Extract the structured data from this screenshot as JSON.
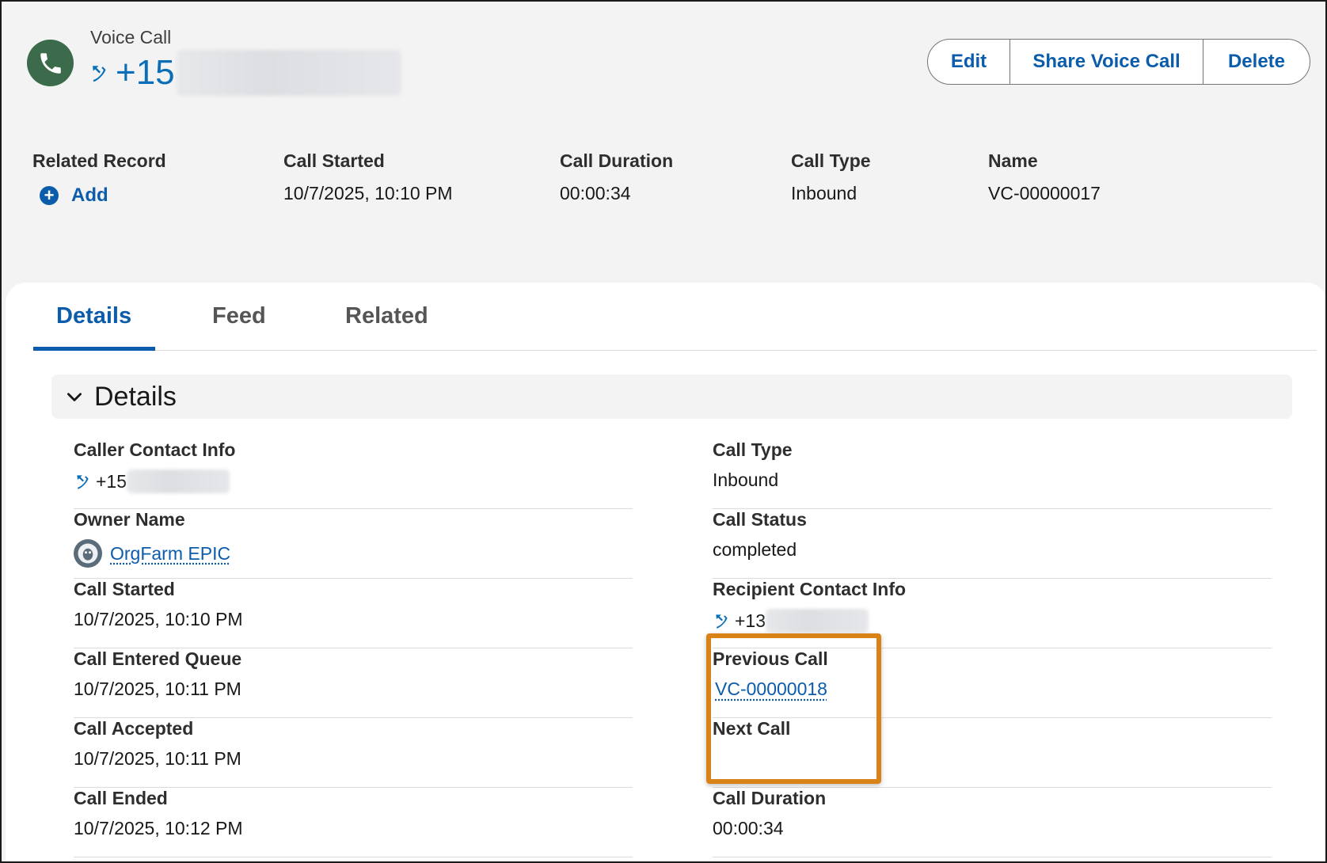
{
  "header": {
    "object_label": "Voice Call",
    "record_title_prefix": "+15",
    "actions": {
      "edit": "Edit",
      "share": "Share Voice Call",
      "delete": "Delete"
    },
    "highlights": {
      "related_record": {
        "label": "Related Record",
        "add_label": "Add"
      },
      "call_started": {
        "label": "Call Started",
        "value": "10/7/2025, 10:10 PM"
      },
      "call_duration": {
        "label": "Call Duration",
        "value": "00:00:34"
      },
      "call_type": {
        "label": "Call Type",
        "value": "Inbound"
      },
      "name": {
        "label": "Name",
        "value": "VC-00000017"
      }
    }
  },
  "tabs": {
    "details": "Details",
    "feed": "Feed",
    "related": "Related"
  },
  "section": {
    "title": "Details"
  },
  "fields_left": {
    "caller_contact_info": {
      "label": "Caller Contact Info",
      "value": "+15"
    },
    "owner_name": {
      "label": "Owner Name",
      "value": "OrgFarm EPIC"
    },
    "call_started": {
      "label": "Call Started",
      "value": "10/7/2025, 10:10 PM"
    },
    "call_entered_queue": {
      "label": "Call Entered Queue",
      "value": "10/7/2025, 10:11 PM"
    },
    "call_accepted": {
      "label": "Call Accepted",
      "value": "10/7/2025, 10:11 PM"
    },
    "call_ended": {
      "label": "Call Ended",
      "value": "10/7/2025, 10:12 PM"
    }
  },
  "fields_right": {
    "call_type": {
      "label": "Call Type",
      "value": "Inbound"
    },
    "call_status": {
      "label": "Call Status",
      "value": "completed"
    },
    "recipient_contact_info": {
      "label": "Recipient Contact Info",
      "value": "+13"
    },
    "previous_call": {
      "label": "Previous Call",
      "value": "VC-00000018"
    },
    "next_call": {
      "label": "Next Call",
      "value": ""
    },
    "call_duration": {
      "label": "Call Duration",
      "value": "00:00:34"
    }
  },
  "colors": {
    "brand": "#0b5cab",
    "phone_link": "#0b6fb8",
    "icon_green": "#3b6b4a",
    "highlight_orange": "#d98218"
  }
}
